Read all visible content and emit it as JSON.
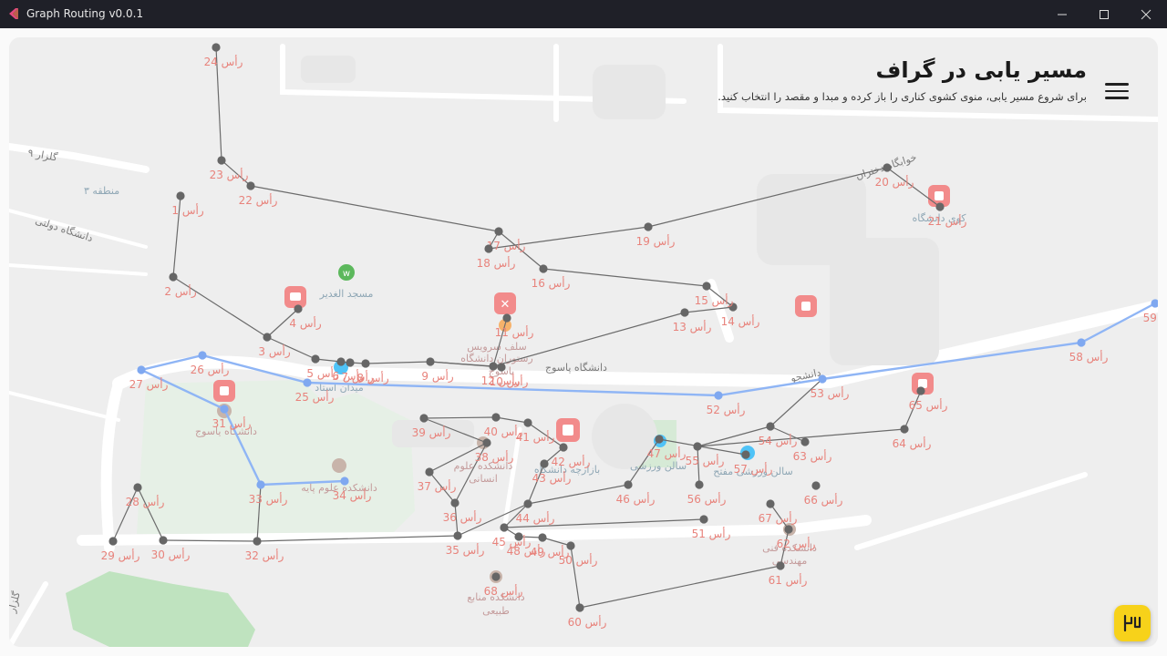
{
  "window": {
    "title": "Graph Routing v0.0.1",
    "controls": [
      "minimize-icon",
      "maximize-icon",
      "close-icon"
    ]
  },
  "header": {
    "title": "مسیر یابی در گراف",
    "subtitle": "برای شروع مسیر یابی، منوی کشوی کناری را باز کرده و مبدا و مقصد را انتخاب کنید."
  },
  "menu_icon": "hamburger-menu-icon",
  "fab_icon": "directions-icon",
  "colors": {
    "accent": "#f7d21a",
    "route": "#8fb5f5",
    "vertex": "#666666",
    "vertex_label": "#e8837c",
    "edge": "#6b6b6b",
    "poi": "#f08a8a"
  },
  "roads_labels": [
    {
      "id": "r1",
      "text": "دانشجو"
    },
    {
      "id": "r2",
      "text": "گلزار ۹"
    },
    {
      "id": "r3",
      "text": "دانشگاه دولتی"
    },
    {
      "id": "r4",
      "text": "منطقه ۳"
    },
    {
      "id": "r5",
      "text": "گلزار"
    },
    {
      "id": "r6",
      "text": "دانشگاه پاسوج"
    },
    {
      "id": "r7",
      "text": "خوابگاه دختران"
    }
  ],
  "places": [
    {
      "id": "p1",
      "text": "مسجد الغدیر"
    },
    {
      "id": "p2",
      "text": "کوی دانشگاه"
    },
    {
      "id": "p3",
      "text": "سلف سرویس"
    },
    {
      "id": "p4",
      "text": "رستوران دانشگاه"
    },
    {
      "id": "p5",
      "text": "یاسوج"
    },
    {
      "id": "p6",
      "text": "میدان استاد"
    },
    {
      "id": "p7",
      "text": "دانشگاه یاسوج"
    },
    {
      "id": "p8",
      "text": "دانشکده علوم پایه"
    },
    {
      "id": "p9",
      "text": "دانشکده علوم"
    },
    {
      "id": "p10",
      "text": "انسانی"
    },
    {
      "id": "p11",
      "text": "بازارچه دانشگاه"
    },
    {
      "id": "p12",
      "text": "سالن ورزشی"
    },
    {
      "id": "p13",
      "text": "سالن ورزشی مفتح"
    },
    {
      "id": "p14",
      "text": "دانشکده فنی"
    },
    {
      "id": "p15",
      "text": "مهندسی"
    },
    {
      "id": "p16",
      "text": "دانشکده منابع"
    },
    {
      "id": "p17",
      "text": "طبیعی"
    }
  ],
  "vertices": [
    {
      "id": 1,
      "label": "رأس 1"
    },
    {
      "id": 2,
      "label": "رأس 2"
    },
    {
      "id": 3,
      "label": "رأس 3"
    },
    {
      "id": 4,
      "label": "رأس 4"
    },
    {
      "id": 5,
      "label": "رأس 5"
    },
    {
      "id": 6,
      "label": "رأس 6"
    },
    {
      "id": 7,
      "label": "رأس 7"
    },
    {
      "id": 8,
      "label": "رأس 8"
    },
    {
      "id": 9,
      "label": "رأس 9"
    },
    {
      "id": 10,
      "label": "رأس 10"
    },
    {
      "id": 11,
      "label": "رأس 11"
    },
    {
      "id": 12,
      "label": "رأس 12"
    },
    {
      "id": 13,
      "label": "رأس 13"
    },
    {
      "id": 14,
      "label": "رأس 14"
    },
    {
      "id": 15,
      "label": "رأس 15"
    },
    {
      "id": 16,
      "label": "رأس 16"
    },
    {
      "id": 17,
      "label": "رأس 17"
    },
    {
      "id": 18,
      "label": "رأس 18"
    },
    {
      "id": 19,
      "label": "رأس 19"
    },
    {
      "id": 20,
      "label": "رأس 20"
    },
    {
      "id": 21,
      "label": "رأس 21"
    },
    {
      "id": 22,
      "label": "رأس 22"
    },
    {
      "id": 23,
      "label": "رأس 23"
    },
    {
      "id": 24,
      "label": "رأس 24"
    },
    {
      "id": 25,
      "label": "رأس 25"
    },
    {
      "id": 26,
      "label": "رأس 26"
    },
    {
      "id": 27,
      "label": "رأس 27"
    },
    {
      "id": 28,
      "label": "رأس 28"
    },
    {
      "id": 29,
      "label": "رأس 29"
    },
    {
      "id": 30,
      "label": "رأس 30"
    },
    {
      "id": 31,
      "label": "رأس 31"
    },
    {
      "id": 32,
      "label": "رأس 32"
    },
    {
      "id": 33,
      "label": "رأس 33"
    },
    {
      "id": 34,
      "label": "رأس 34"
    },
    {
      "id": 35,
      "label": "رأس 35"
    },
    {
      "id": 36,
      "label": "رأس 36"
    },
    {
      "id": 37,
      "label": "رأس 37"
    },
    {
      "id": 38,
      "label": "رأس 38"
    },
    {
      "id": 39,
      "label": "رأس 39"
    },
    {
      "id": 40,
      "label": "رأس 40"
    },
    {
      "id": 41,
      "label": "رأس 41"
    },
    {
      "id": 42,
      "label": "رأس 42"
    },
    {
      "id": 43,
      "label": "رأس 43"
    },
    {
      "id": 44,
      "label": "رأس 44"
    },
    {
      "id": 45,
      "label": "رأس 45"
    },
    {
      "id": 46,
      "label": "رأس 46"
    },
    {
      "id": 47,
      "label": "رأس 47"
    },
    {
      "id": 48,
      "label": "رأس 48"
    },
    {
      "id": 49,
      "label": "رأس 49"
    },
    {
      "id": 50,
      "label": "رأس 50"
    },
    {
      "id": 51,
      "label": "رأس 51"
    },
    {
      "id": 52,
      "label": "رأس 52"
    },
    {
      "id": 53,
      "label": "رأس 53"
    },
    {
      "id": 54,
      "label": "رأس 54"
    },
    {
      "id": 55,
      "label": "رأس 55"
    },
    {
      "id": 56,
      "label": "رأس 56"
    },
    {
      "id": 57,
      "label": "رأس 57"
    },
    {
      "id": 58,
      "label": "رأس 58"
    },
    {
      "id": 59,
      "label": "رأس 59"
    },
    {
      "id": 60,
      "label": "رأس 60"
    },
    {
      "id": 61,
      "label": "رأس 61"
    },
    {
      "id": 62,
      "label": "رأس 62"
    },
    {
      "id": 63,
      "label": "رأس 63"
    },
    {
      "id": 64,
      "label": "رأس 64"
    },
    {
      "id": 65,
      "label": "رأس 65"
    },
    {
      "id": 66,
      "label": "رأس 66"
    },
    {
      "id": 67,
      "label": "رأس 67"
    },
    {
      "id": 68,
      "label": "رأس 68"
    }
  ],
  "edges": [
    [
      24,
      23
    ],
    [
      23,
      22
    ],
    [
      22,
      17
    ],
    [
      1,
      2
    ],
    [
      2,
      3
    ],
    [
      3,
      4
    ],
    [
      3,
      5
    ],
    [
      5,
      6
    ],
    [
      6,
      7
    ],
    [
      7,
      8
    ],
    [
      8,
      9
    ],
    [
      9,
      12
    ],
    [
      11,
      12
    ],
    [
      12,
      13
    ],
    [
      13,
      14
    ],
    [
      14,
      15
    ],
    [
      15,
      16
    ],
    [
      16,
      17
    ],
    [
      17,
      18
    ],
    [
      18,
      19
    ],
    [
      19,
      20
    ],
    [
      20,
      21
    ],
    [
      9,
      10
    ],
    [
      28,
      29
    ],
    [
      28,
      30
    ],
    [
      30,
      32
    ],
    [
      32,
      33
    ],
    [
      33,
      34
    ],
    [
      32,
      35
    ],
    [
      35,
      44
    ],
    [
      35,
      36
    ],
    [
      36,
      37
    ],
    [
      37,
      38
    ],
    [
      38,
      39
    ],
    [
      39,
      40
    ],
    [
      40,
      41
    ],
    [
      41,
      42
    ],
    [
      42,
      43
    ],
    [
      43,
      44
    ],
    [
      36,
      38
    ],
    [
      44,
      45
    ],
    [
      45,
      48
    ],
    [
      48,
      49
    ],
    [
      49,
      50
    ],
    [
      50,
      60
    ],
    [
      60,
      61
    ],
    [
      45,
      51
    ],
    [
      44,
      46
    ],
    [
      46,
      47
    ],
    [
      47,
      57
    ],
    [
      55,
      54
    ],
    [
      54,
      53
    ],
    [
      55,
      56
    ],
    [
      55,
      64
    ],
    [
      64,
      65
    ],
    [
      54,
      63
    ],
    [
      61,
      62
    ],
    [
      62,
      67
    ]
  ],
  "route": [
    59,
    58,
    53,
    52,
    25,
    26,
    27,
    31,
    33,
    34
  ]
}
